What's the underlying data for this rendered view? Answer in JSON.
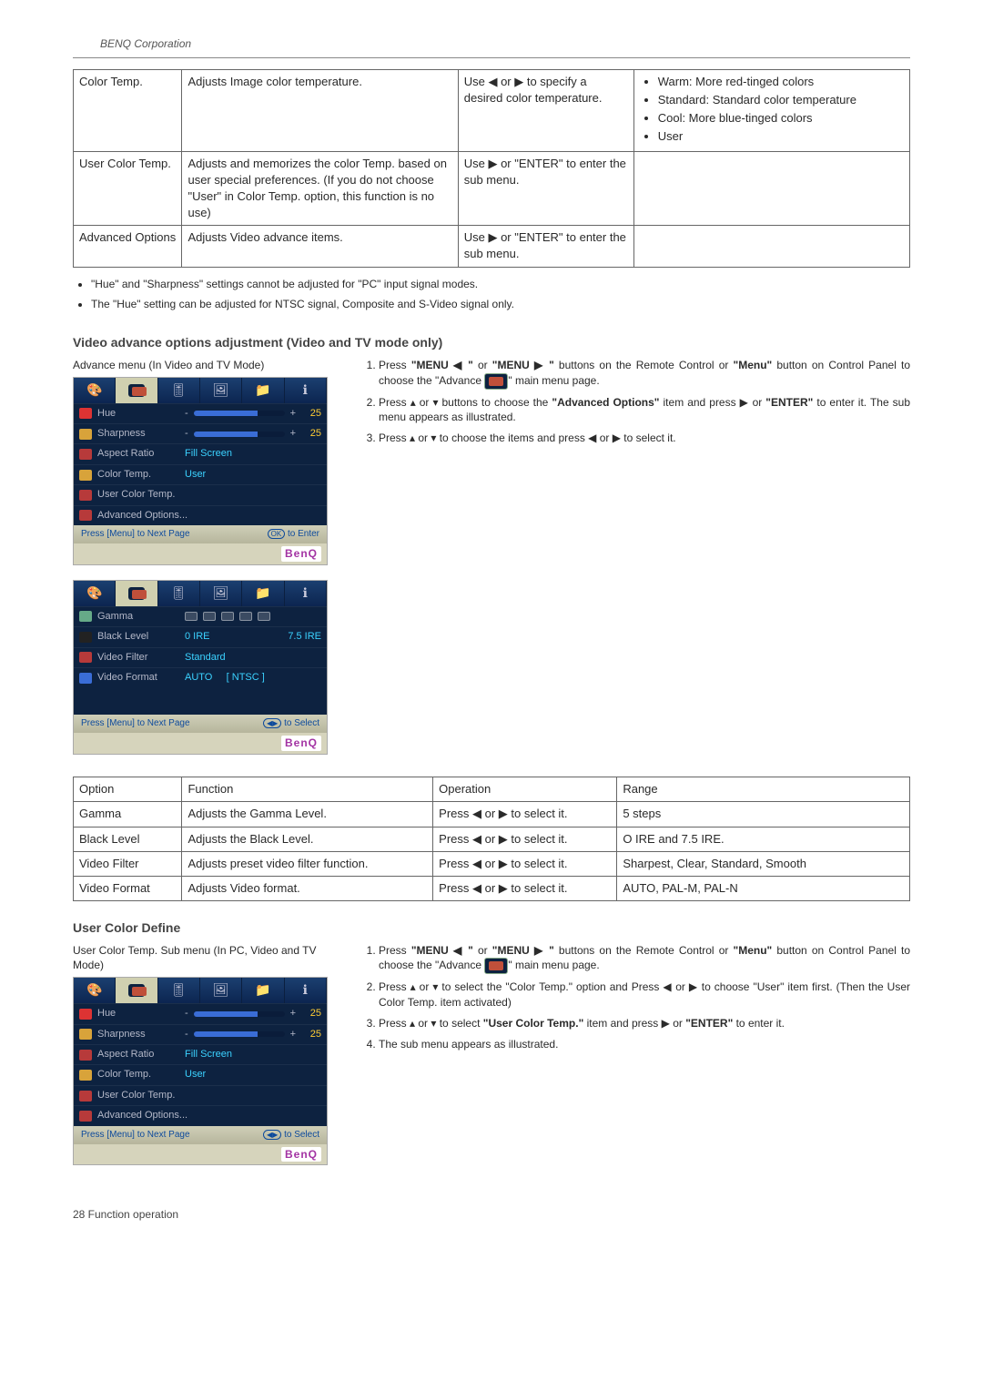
{
  "corp": "BENQ Corporation",
  "t1": {
    "r1": {
      "opt": "Color Temp.",
      "fn": "Adjusts Image color temperature.",
      "op": "Use ◀ or ▶ to specify a desired color temperature.",
      "range": [
        "Warm: More red-tinged colors",
        "Standard: Standard color temperature",
        "Cool: More blue-tinged colors",
        "User"
      ]
    },
    "r2": {
      "opt": "User Color Temp.",
      "fn": "Adjusts and memorizes the color Temp. based on user special preferences. (If you do not choose \"User\" in Color Temp. option, this function is no use)",
      "op": "Use ▶ or \"ENTER\" to enter the sub menu."
    },
    "r3": {
      "opt": "Advanced Options",
      "fn": "Adjusts Video advance items.",
      "op": "Use ▶ or \"ENTER\" to enter the sub menu."
    }
  },
  "notes": {
    "n1": "\"Hue\" and \"Sharpness\" settings cannot be adjusted for \"PC\" input signal modes.",
    "n2": "The \"Hue\" setting can be adjusted for NTSC signal, Composite and S-Video signal only."
  },
  "sec_vid": {
    "title": "Video advance options adjustment (Video and TV mode only)",
    "caption": "Advance menu (In Video and TV Mode)",
    "osd1": {
      "hue": "Hue",
      "hue_v": "25",
      "sharp": "Sharpness",
      "sharp_v": "25",
      "aspect": "Aspect Ratio",
      "aspect_v": "Fill Screen",
      "ctemp": "Color Temp.",
      "ctemp_v": "User",
      "uct": "User Color Temp.",
      "adv": "Advanced Options...",
      "foot_l": "Press [Menu] to Next Page",
      "foot_r": "to Enter",
      "brand": "BenQ"
    },
    "osd2": {
      "gamma": "Gamma",
      "black": "Black Level",
      "black_v1": "0 IRE",
      "black_v2": "7.5 IRE",
      "vfilter": "Video Filter",
      "vfilter_v": "Standard",
      "vformat": "Video Format",
      "vformat_v": "AUTO     [ NTSC ]",
      "foot_l": "Press [Menu] to Next Page",
      "foot_r": "to Select",
      "brand": "BenQ"
    },
    "instr": {
      "i1a": "Press ",
      "i1b": "\"MENU ◀ \"",
      "i1c": " or ",
      "i1d": "\"MENU ▶ \"",
      "i1e": " buttons on the Remote Control or ",
      "i1f": "\"Menu\"",
      "i1g": " button on Control Panel to choose the \"Advance",
      "i1h": "\" main menu page.",
      "i2a": "Press ▴ or ▾ buttons to choose the ",
      "i2b": "\"Advanced Options\"",
      "i2c": " item and press ▶ or ",
      "i2d": "\"ENTER\"",
      "i2e": " to enter it. The sub menu appears as illustrated.",
      "i3": "Press ▴ or ▾ to choose the items and press ◀ or ▶ to select it."
    }
  },
  "t2": {
    "h1": "Option",
    "h2": "Function",
    "h3": "Operation",
    "h4": "Range",
    "r1": {
      "o": "Gamma",
      "f": "Adjusts the Gamma Level.",
      "op": "Press ◀ or ▶ to select it.",
      "r": "5 steps"
    },
    "r2": {
      "o": "Black Level",
      "f": "Adjusts the Black Level.",
      "op": "Press ◀ or ▶ to select it.",
      "r": "O IRE and 7.5 IRE."
    },
    "r3": {
      "o": "Video Filter",
      "f": "Adjusts preset video filter function.",
      "op": "Press ◀ or ▶ to select it.",
      "r": "Sharpest, Clear, Standard, Smooth"
    },
    "r4": {
      "o": "Video Format",
      "f": "Adjusts Video format.",
      "op": "Press ◀ or ▶ to select it.",
      "r": "AUTO, PAL-M, PAL-N"
    }
  },
  "sec_ucd": {
    "title": "User Color Define",
    "caption": "User Color Temp. Sub menu (In PC, Video and TV Mode)",
    "instr": {
      "i1a": "Press ",
      "i1b": "\"MENU ◀ \"",
      "i1c": " or ",
      "i1d": "\"MENU ▶ \"",
      "i1e": " buttons on the Remote Control or ",
      "i1f": "\"Menu\"",
      "i1g": " button on Control Panel to choose the \"Advance",
      "i1h": "\" main menu page.",
      "i2": "Press ▴ or ▾ to select the \"Color Temp.\" option and Press ◀ or ▶ to choose \"User\" item first. (Then the User Color Temp. item activated)",
      "i3a": "Press ▴ or ▾ to select ",
      "i3b": "\"User Color Temp.\"",
      "i3c": " item and press ▶ or ",
      "i3d": "\"ENTER\"",
      "i3e": " to enter it.",
      "i4": "The sub menu appears as illustrated."
    }
  },
  "footer": "28   Function operation"
}
